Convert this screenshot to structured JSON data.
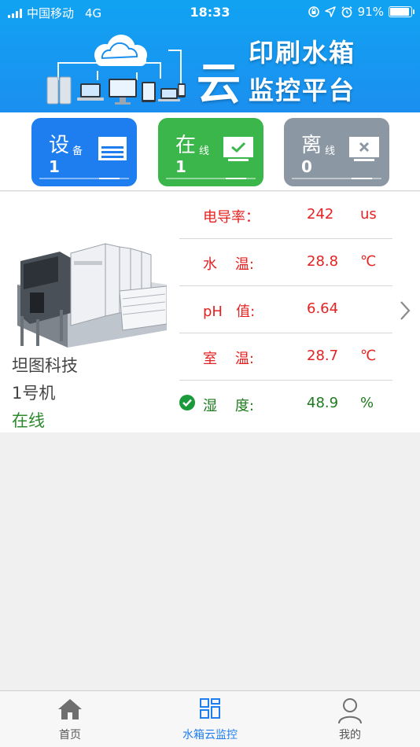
{
  "status_bar": {
    "carrier": "中国移动",
    "network": "4G",
    "time": "18:33",
    "battery": "91%",
    "battery_level": 0.91
  },
  "banner": {
    "yun": "云",
    "line1": "印刷水箱",
    "line2": "监控平台"
  },
  "summary": {
    "device": {
      "title": "设",
      "sub": "备",
      "count": "1",
      "color": "#1e7ef0"
    },
    "online": {
      "title": "在",
      "sub": "线",
      "count": "1",
      "color": "#3ab64a"
    },
    "offline": {
      "title": "离",
      "sub": "线",
      "count": "0",
      "color": "#8b97a3"
    }
  },
  "device": {
    "company": "坦图科技",
    "name": "1号机",
    "status": "在线",
    "readings": [
      {
        "label": "电导率：",
        "value": "242",
        "unit": "us",
        "status": "alarm"
      },
      {
        "label": "水    温:",
        "value": "28.8",
        "unit": "℃",
        "status": "alarm"
      },
      {
        "label": "pH   值:",
        "value": "6.64",
        "unit": "",
        "status": "alarm"
      },
      {
        "label": "室    温:",
        "value": "28.7",
        "unit": "℃",
        "status": "alarm"
      },
      {
        "label": "湿    度:",
        "value": "48.9",
        "unit": "%",
        "status": "ok"
      }
    ]
  },
  "tabbar": {
    "home": "首页",
    "monitor": "水箱云监控",
    "mine": "我的"
  },
  "colors": {
    "alarm": "#e52222",
    "ok": "#1e7a1e",
    "accent": "#1e7ef0"
  }
}
